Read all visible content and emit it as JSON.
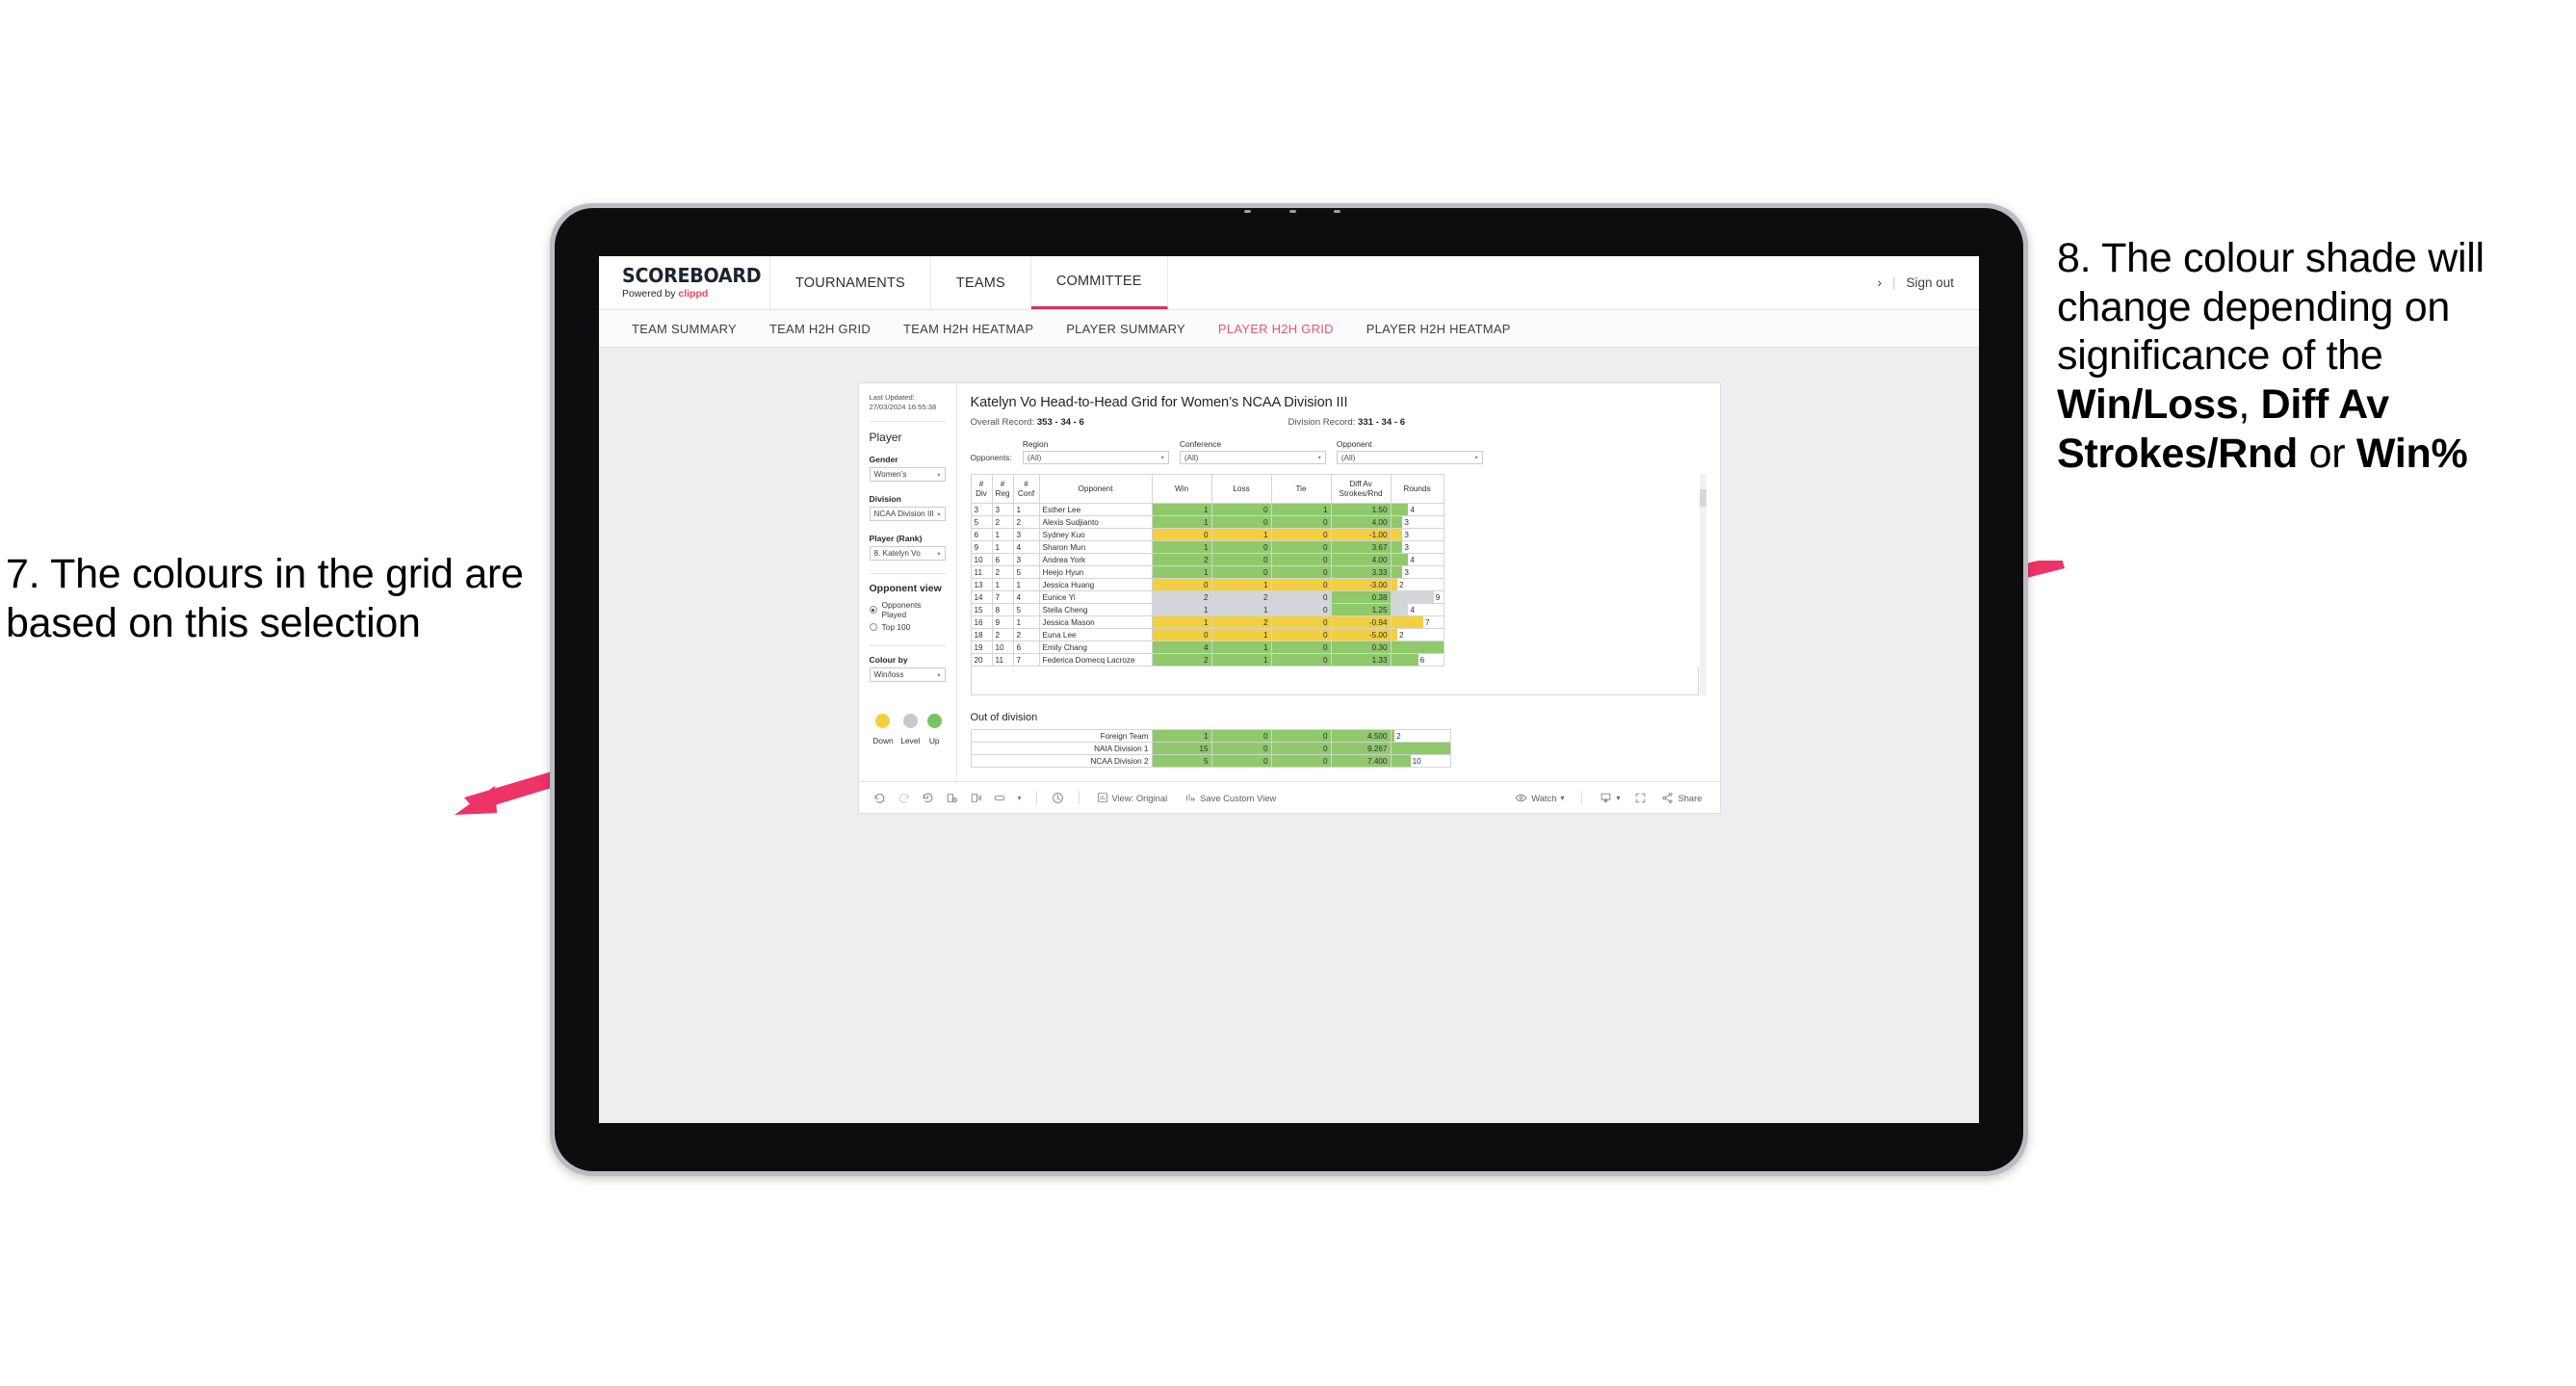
{
  "annotations": {
    "left": {
      "text": "7. The colours in the grid are based on this selection",
      "number": "7"
    },
    "right": {
      "lead": "8. The colour shade will change depending on significance of the ",
      "bold1": "Win/Loss",
      "mid1": ", ",
      "bold2": "Diff Av Strokes/Rnd",
      "mid2": " or ",
      "bold3": "Win%"
    },
    "arrow_color": "#ee3368"
  },
  "header": {
    "brand_title": "SCOREBOARD",
    "brand_sub_prefix": "Powered by ",
    "brand_sub_accent": "clippd",
    "nav": [
      {
        "label": "TOURNAMENTS",
        "active": false
      },
      {
        "label": "TEAMS",
        "active": false
      },
      {
        "label": "COMMITTEE",
        "active": true
      }
    ],
    "chevron": "›",
    "divider": "|",
    "sign_out": "Sign out"
  },
  "subnav": {
    "tabs": [
      {
        "label": "TEAM SUMMARY",
        "active": false
      },
      {
        "label": "TEAM H2H GRID",
        "active": false
      },
      {
        "label": "TEAM H2H HEATMAP",
        "active": false
      },
      {
        "label": "PLAYER SUMMARY",
        "active": false
      },
      {
        "label": "PLAYER H2H GRID",
        "active": true
      },
      {
        "label": "PLAYER H2H HEATMAP",
        "active": false
      }
    ]
  },
  "sidebar": {
    "last_updated": "Last Updated: 27/03/2024 16:55:38",
    "player_heading": "Player",
    "gender": {
      "label": "Gender",
      "value": "Women’s"
    },
    "division": {
      "label": "Division",
      "value": "NCAA Division III"
    },
    "player_rank": {
      "label": "Player (Rank)",
      "value": "8. Katelyn Vo"
    },
    "opponent_view": {
      "heading": "Opponent view",
      "options": [
        {
          "label": "Opponents Played",
          "selected": true
        },
        {
          "label": "Top 100",
          "selected": false
        }
      ]
    },
    "colour_by": {
      "label": "Colour by",
      "value": "Win/loss"
    },
    "legend": [
      {
        "label": "Down",
        "color": "#f2cf3f"
      },
      {
        "label": "Level",
        "color": "#c6c9ce"
      },
      {
        "label": "Up",
        "color": "#78c45a"
      }
    ]
  },
  "main": {
    "title": "Katelyn Vo Head-to-Head Grid for Women’s NCAA Division III",
    "overall_record_label": "Overall Record: ",
    "overall_record_value": "353 -  34 - 6",
    "division_record_label": "Division Record: ",
    "division_record_value": "331 -  34 - 6",
    "opponents_label": "Opponents:",
    "filters": [
      {
        "label": "Region",
        "value": "(All)"
      },
      {
        "label": "Conference",
        "value": "(All)"
      },
      {
        "label": "Opponent",
        "value": "(All)"
      }
    ],
    "out_of_division_title": "Out of division"
  },
  "chart_data": {
    "type": "table",
    "title": "Katelyn Vo Head-to-Head Grid for Women’s NCAA Division III",
    "columns": [
      "# Div",
      "# Reg",
      "# Conf",
      "Opponent",
      "Win",
      "Loss",
      "Tie",
      "Diff Av Strokes/Rnd",
      "Rounds"
    ],
    "column_header_lines": [
      [
        "#",
        "Div"
      ],
      [
        "#",
        "Reg"
      ],
      [
        "#",
        "Conf"
      ],
      [
        "Opponent"
      ],
      [
        "Win"
      ],
      [
        "Loss"
      ],
      [
        "Tie"
      ],
      [
        "Diff Av",
        "Strokes/Rnd"
      ],
      [
        "Rounds"
      ]
    ],
    "colour_by": "Win/loss",
    "colour_scale": {
      "down": "#f2cf3f",
      "level": "#d3d5d8",
      "up": "#8fc96b"
    },
    "rows": [
      {
        "div": "3",
        "reg": "3",
        "conf": "1",
        "opponent": "Esther Lee",
        "win": "1",
        "loss": "0",
        "tie": "1",
        "diff": "1.50",
        "rounds": "4",
        "color": "#8fc96b",
        "rounds_pct": 33
      },
      {
        "div": "5",
        "reg": "2",
        "conf": "2",
        "opponent": "Alexis Sudjianto",
        "win": "1",
        "loss": "0",
        "tie": "0",
        "diff": "4.00",
        "rounds": "3",
        "color": "#8fc96b",
        "rounds_pct": 22
      },
      {
        "div": "6",
        "reg": "1",
        "conf": "3",
        "opponent": "Sydney Kuo",
        "win": "0",
        "loss": "1",
        "tie": "0",
        "diff": "-1.00",
        "rounds": "3",
        "color": "#f2cf3f",
        "rounds_pct": 22
      },
      {
        "div": "9",
        "reg": "1",
        "conf": "4",
        "opponent": "Sharon Mun",
        "win": "1",
        "loss": "0",
        "tie": "0",
        "diff": "3.67",
        "rounds": "3",
        "color": "#8fc96b",
        "rounds_pct": 22
      },
      {
        "div": "10",
        "reg": "6",
        "conf": "3",
        "opponent": "Andrea York",
        "win": "2",
        "loss": "0",
        "tie": "0",
        "diff": "4.00",
        "rounds": "4",
        "color": "#8fc96b",
        "rounds_pct": 33
      },
      {
        "div": "11",
        "reg": "2",
        "conf": "5",
        "opponent": "Heejo Hyun",
        "win": "1",
        "loss": "0",
        "tie": "0",
        "diff": "3.33",
        "rounds": "3",
        "color": "#8fc96b",
        "rounds_pct": 22
      },
      {
        "div": "13",
        "reg": "1",
        "conf": "1",
        "opponent": "Jessica Huang",
        "win": "0",
        "loss": "1",
        "tie": "0",
        "diff": "-3.00",
        "rounds": "2",
        "color": "#f2cf3f",
        "rounds_pct": 12
      },
      {
        "div": "14",
        "reg": "7",
        "conf": "4",
        "opponent": "Eunice Yi",
        "win": "2",
        "loss": "2",
        "tie": "0",
        "diff": "0.38",
        "rounds": "9",
        "color": "#d3d5d8",
        "diff_color": "#8fc96b",
        "rounds_pct": 82
      },
      {
        "div": "15",
        "reg": "8",
        "conf": "5",
        "opponent": "Stella Cheng",
        "win": "1",
        "loss": "1",
        "tie": "0",
        "diff": "1.25",
        "rounds": "4",
        "color": "#d3d5d8",
        "diff_color": "#8fc96b",
        "rounds_pct": 33
      },
      {
        "div": "16",
        "reg": "9",
        "conf": "1",
        "opponent": "Jessica Mason",
        "win": "1",
        "loss": "2",
        "tie": "0",
        "diff": "-0.94",
        "rounds": "7",
        "color": "#f2cf3f",
        "rounds_pct": 62
      },
      {
        "div": "18",
        "reg": "2",
        "conf": "2",
        "opponent": "Euna Lee",
        "win": "0",
        "loss": "1",
        "tie": "0",
        "diff": "-5.00",
        "rounds": "2",
        "color": "#f2cf3f",
        "rounds_pct": 12
      },
      {
        "div": "19",
        "reg": "10",
        "conf": "6",
        "opponent": "Emily Chang",
        "win": "4",
        "loss": "1",
        "tie": "0",
        "diff": "0.30",
        "rounds": "11",
        "color": "#8fc96b",
        "rounds_pct": 100
      },
      {
        "div": "20",
        "reg": "11",
        "conf": "7",
        "opponent": "Federica Domecq Lacroze",
        "win": "2",
        "loss": "1",
        "tie": "0",
        "diff": "1.33",
        "rounds": "6",
        "color": "#8fc96b",
        "rounds_pct": 52
      }
    ],
    "out_of_division_rows": [
      {
        "opponent": "Foreign Team",
        "win": "1",
        "loss": "0",
        "tie": "0",
        "diff": "4.500",
        "rounds": "2",
        "color": "#8fc96b",
        "rounds_pct": 6
      },
      {
        "opponent": "NAIA Division 1",
        "win": "15",
        "loss": "0",
        "tie": "0",
        "diff": "9.267",
        "rounds": "30",
        "color": "#8fc96b",
        "rounds_pct": 100
      },
      {
        "opponent": "NCAA Division 2",
        "win": "5",
        "loss": "0",
        "tie": "0",
        "diff": "7.400",
        "rounds": "10",
        "color": "#8fc96b",
        "rounds_pct": 33
      }
    ]
  },
  "toolbar": {
    "view_label": "View: Original",
    "save_custom_view_label": "Save Custom View",
    "watch_label": "Watch",
    "share_label": "Share",
    "caret": "▾"
  }
}
